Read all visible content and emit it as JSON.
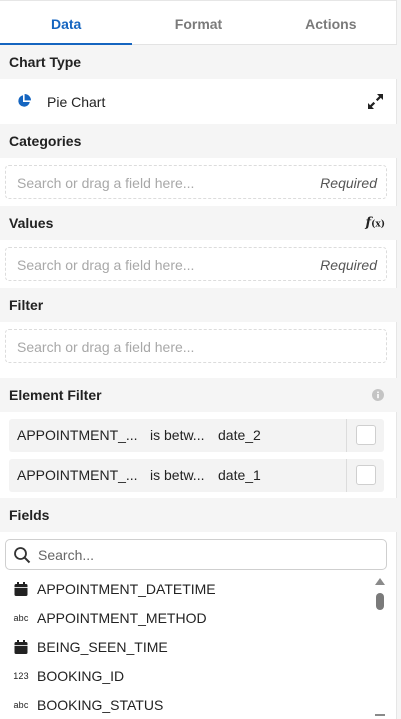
{
  "tabs": [
    {
      "label": "Data",
      "active": true
    },
    {
      "label": "Format",
      "active": false
    },
    {
      "label": "Actions",
      "active": false
    }
  ],
  "chart_type": {
    "heading": "Chart Type",
    "value": "Pie Chart",
    "icon": "pie-chart-icon",
    "expand_icon": "expand-icon"
  },
  "categories": {
    "heading": "Categories",
    "placeholder": "Search or drag a field here...",
    "required_label": "Required"
  },
  "values": {
    "heading": "Values",
    "formula_label": "f(x)",
    "placeholder": "Search or drag a field here...",
    "required_label": "Required"
  },
  "filter": {
    "heading": "Filter",
    "placeholder": "Search or drag a field here..."
  },
  "element_filter": {
    "heading": "Element Filter",
    "info_icon": "info-icon",
    "rows": [
      {
        "field": "APPOINTMENT_...",
        "operator": "is betw...",
        "value": "date_2"
      },
      {
        "field": "APPOINTMENT_...",
        "operator": "is betw...",
        "value": "date_1"
      }
    ]
  },
  "fields": {
    "heading": "Fields",
    "search_placeholder": "Search...",
    "items": [
      {
        "type_icon": "calendar-icon",
        "type_label": "",
        "name": "APPOINTMENT_DATETIME"
      },
      {
        "type_icon": "text-type-icon",
        "type_label": "abc",
        "name": "APPOINTMENT_METHOD"
      },
      {
        "type_icon": "calendar-icon",
        "type_label": "",
        "name": "BEING_SEEN_TIME"
      },
      {
        "type_icon": "number-type-icon",
        "type_label": "123",
        "name": "BOOKING_ID"
      },
      {
        "type_icon": "text-type-icon",
        "type_label": "abc",
        "name": "BOOKING_STATUS"
      }
    ]
  },
  "colors": {
    "accent": "#1565c0",
    "section_bg": "#f5f5f5"
  }
}
